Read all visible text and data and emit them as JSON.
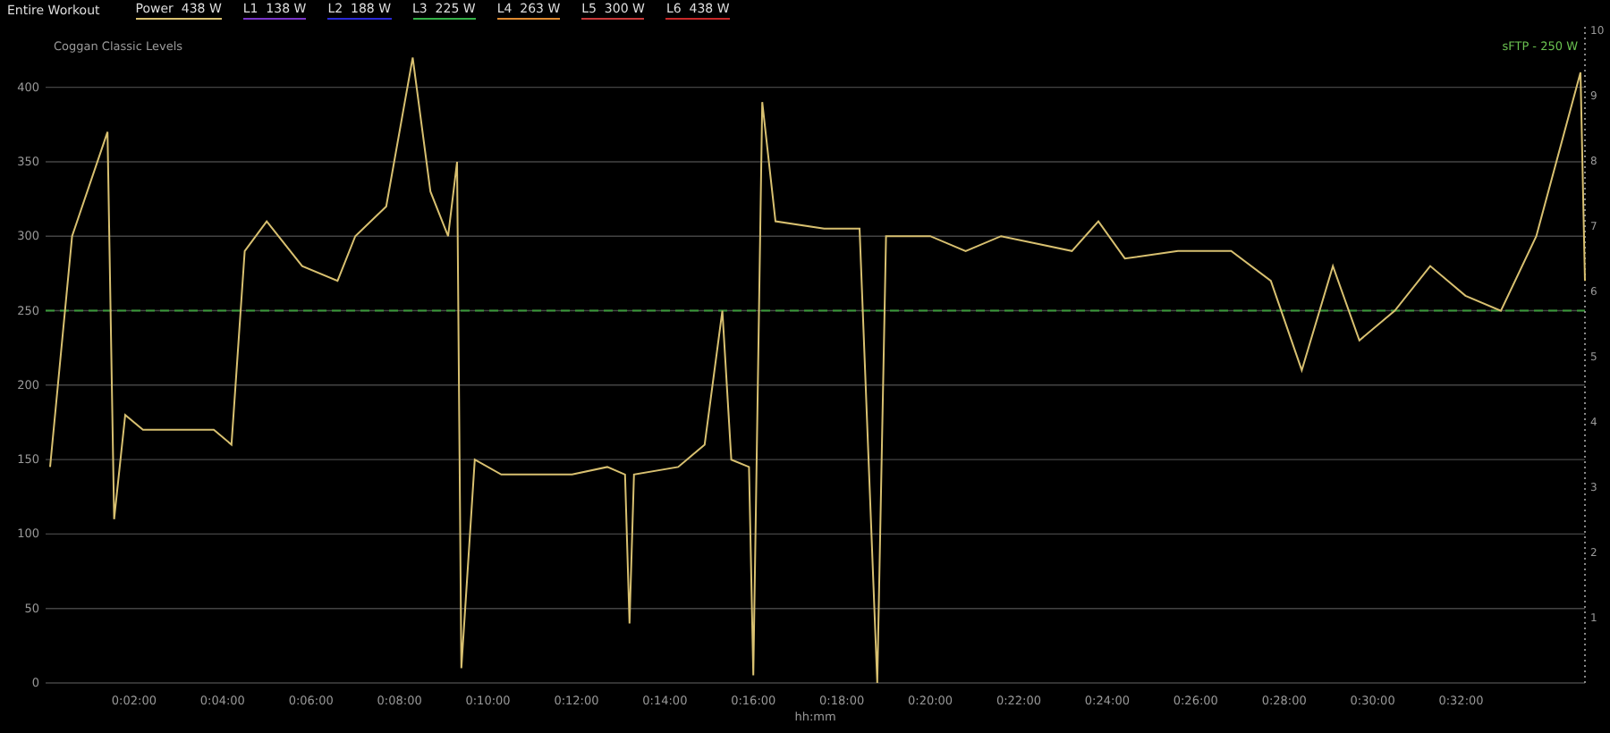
{
  "header": {
    "title": "Entire Workout",
    "legend": [
      {
        "label": "Power  438 W",
        "color": "#d8c070"
      },
      {
        "label": "L1  138 W",
        "color": "#7a35c8"
      },
      {
        "label": "L2  188 W",
        "color": "#2a2ad8"
      },
      {
        "label": "L3  225 W",
        "color": "#34b048"
      },
      {
        "label": "L4  263 W",
        "color": "#e08a30"
      },
      {
        "label": "L5  300 W",
        "color": "#c83a3a"
      },
      {
        "label": "L6  438 W",
        "color": "#c82828"
      }
    ]
  },
  "chart": {
    "subtitle": "Coggan Classic Levels",
    "threshold_label": "sFTP - 250 W",
    "right_axis_ticks": [
      "10",
      "9",
      "8",
      "7",
      "6",
      "5",
      "4",
      "3",
      "2",
      "1"
    ],
    "chart_data": {
      "type": "line",
      "xlabel": "hh:mm",
      "ylim": [
        0,
        440
      ],
      "xlim": [
        0,
        34.8
      ],
      "grid": true,
      "yticks": [
        0,
        50,
        100,
        150,
        200,
        250,
        300,
        350,
        400
      ],
      "xticks": [
        {
          "value": 2,
          "label": "0:02:00"
        },
        {
          "value": 4,
          "label": "0:04:00"
        },
        {
          "value": 6,
          "label": "0:06:00"
        },
        {
          "value": 8,
          "label": "0:08:00"
        },
        {
          "value": 10,
          "label": "0:10:00"
        },
        {
          "value": 12,
          "label": "0:12:00"
        },
        {
          "value": 14,
          "label": "0:14:00"
        },
        {
          "value": 16,
          "label": "0:16:00"
        },
        {
          "value": 18,
          "label": "0:18:00"
        },
        {
          "value": 20,
          "label": "0:20:00"
        },
        {
          "value": 22,
          "label": "0:22:00"
        },
        {
          "value": 24,
          "label": "0:24:00"
        },
        {
          "value": 26,
          "label": "0:26:00"
        },
        {
          "value": 28,
          "label": "0:28:00"
        },
        {
          "value": 30,
          "label": "0:30:00"
        },
        {
          "value": 32,
          "label": "0:32:00"
        }
      ],
      "x": [
        0.1,
        0.6,
        1.4,
        1.55,
        1.8,
        2.2,
        3.0,
        3.8,
        4.2,
        4.5,
        5.0,
        5.8,
        6.6,
        7.0,
        7.7,
        8.3,
        8.7,
        9.1,
        9.3,
        9.4,
        9.7,
        10.3,
        11.1,
        11.9,
        12.7,
        13.1,
        13.2,
        13.3,
        14.3,
        14.9,
        15.3,
        15.5,
        15.9,
        16.0,
        16.2,
        16.5,
        17.6,
        18.4,
        18.8,
        19.0,
        20.0,
        20.8,
        21.6,
        22.4,
        23.2,
        23.8,
        24.4,
        25.6,
        26.8,
        27.7,
        28.4,
        29.1,
        29.7,
        30.5,
        31.3,
        32.1,
        32.9,
        33.7,
        34.7,
        34.8
      ],
      "series": [
        {
          "color": "#d8c070",
          "values": [
            145,
            300,
            370,
            110,
            180,
            170,
            170,
            170,
            160,
            290,
            310,
            280,
            270,
            300,
            320,
            420,
            330,
            300,
            350,
            10,
            150,
            140,
            140,
            140,
            145,
            140,
            40,
            140,
            145,
            160,
            250,
            150,
            145,
            5,
            390,
            310,
            305,
            305,
            0,
            300,
            300,
            290,
            300,
            295,
            290,
            310,
            285,
            290,
            290,
            270,
            210,
            280,
            230,
            250,
            280,
            260,
            250,
            300,
            410,
            270
          ]
        }
      ],
      "ref_lines": [
        {
          "axis": "y",
          "value": 250
        }
      ]
    }
  }
}
